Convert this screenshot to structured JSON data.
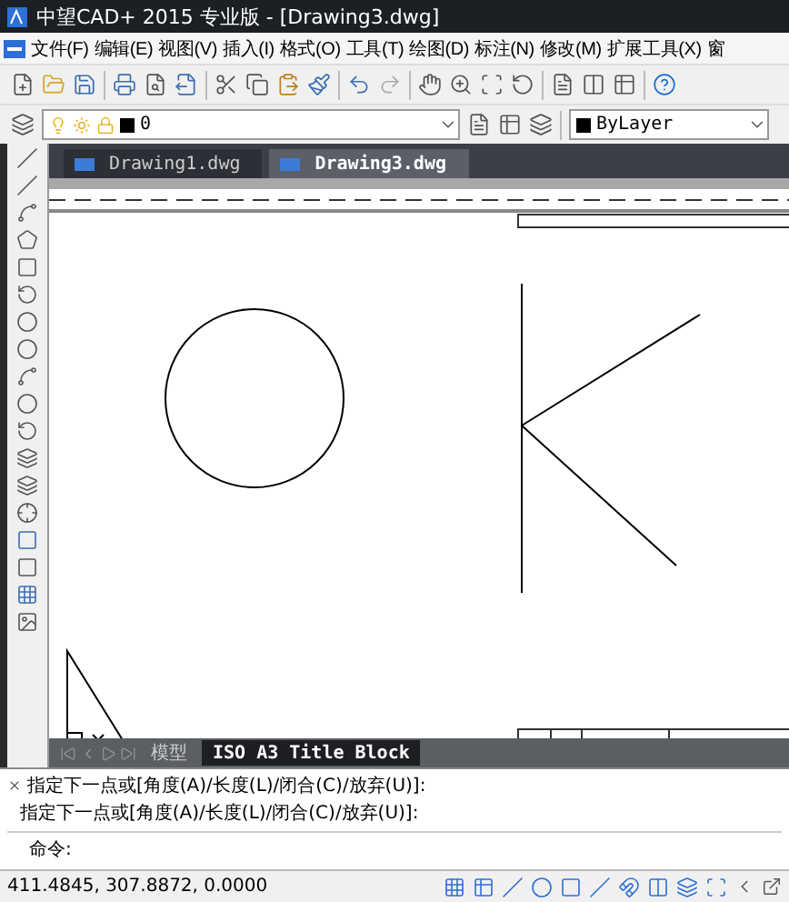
{
  "window": {
    "title": "中望CAD+ 2015 专业版 - [Drawing3.dwg]"
  },
  "menu": [
    "文件(F)",
    "编辑(E)",
    "视图(V)",
    "插入(I)",
    "格式(O)",
    "工具(T)",
    "绘图(D)",
    "标注(N)",
    "修改(M)",
    "扩展工具(X)",
    "窗"
  ],
  "layer": {
    "value": "0"
  },
  "color": {
    "value": "ByLayer"
  },
  "tabs": [
    {
      "label": "Drawing1.dwg",
      "selected": false
    },
    {
      "label": "Drawing3.dwg",
      "selected": true
    }
  ],
  "layout_tabs": [
    {
      "label": "模型",
      "selected": false
    },
    {
      "label": "ISO A3 Title Block",
      "selected": true
    }
  ],
  "command": {
    "history": [
      "指定下一点或[角度(A)/长度(L)/闭合(C)/放弃(U)]:",
      "指定下一点或[角度(A)/长度(L)/闭合(C)/放弃(U)]:"
    ],
    "prompt": "命令:"
  },
  "status_bar": {
    "coordinates": "411.4845, 307.8872, 0.0000"
  }
}
